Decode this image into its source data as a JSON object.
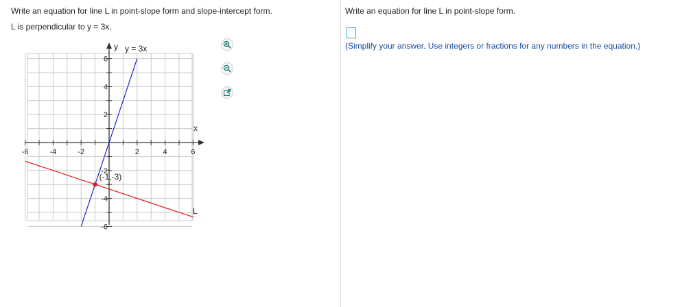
{
  "left": {
    "question_line1": "Write an equation for line L in point-slope form and slope-intercept form.",
    "question_line2": "L is perpendicular to y = 3x."
  },
  "graph": {
    "y_axis_label": "y",
    "x_axis_label": "x",
    "line_blue_label": "y = 3x",
    "line_red_label": "L",
    "point_label": "(-1,-3)",
    "colors": {
      "blue": "#1a22c4",
      "red": "#e01b1b",
      "grid": "#c9c9c9",
      "axis": "#333333"
    }
  },
  "chart_data": {
    "type": "line",
    "title": "",
    "xlim": [
      -6,
      6
    ],
    "ylim": [
      -6,
      6
    ],
    "x_ticks": [
      -6,
      -4,
      -2,
      2,
      4,
      6
    ],
    "y_ticks": [
      6,
      4,
      2,
      -2,
      -4,
      -6
    ],
    "grid": true,
    "series": [
      {
        "name": "y = 3x",
        "x": [
          -2,
          2
        ],
        "y": [
          -6,
          6
        ]
      },
      {
        "name": "L",
        "x": [
          -6,
          6
        ],
        "y": [
          -1.33,
          -5.33
        ]
      }
    ],
    "points": [
      {
        "label": "(-1,-3)",
        "x": -1,
        "y": -3
      }
    ]
  },
  "tools": [
    {
      "name": "zoom-in-icon"
    },
    {
      "name": "zoom-out-icon"
    },
    {
      "name": "popout-icon"
    }
  ],
  "right": {
    "question": "Write an equation for line L in point-slope form.",
    "hint": "(Simplify your answer. Use integers or fractions for any numbers in the equation.)"
  }
}
